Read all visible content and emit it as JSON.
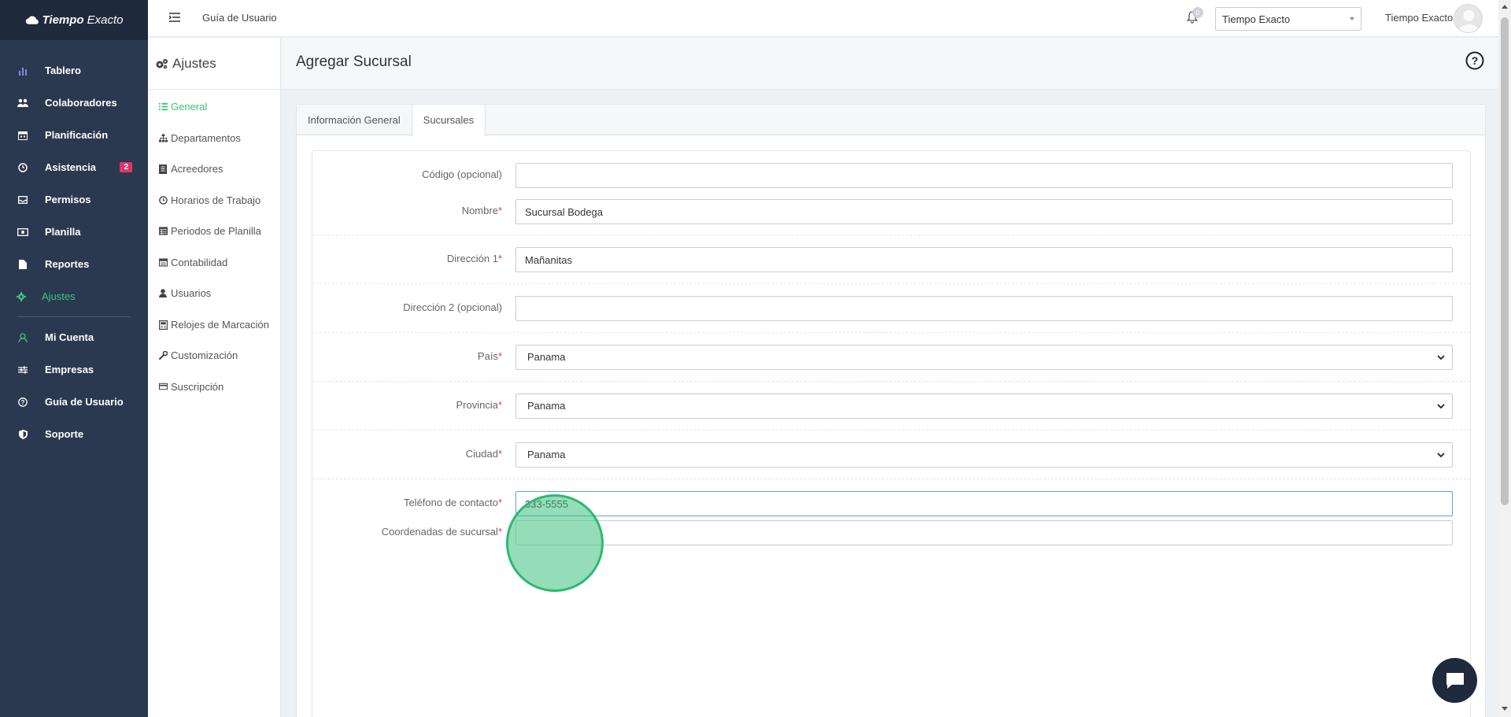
{
  "app": {
    "brand": "TiempoExacto",
    "brand_part1": "Tiempo",
    "brand_part2": "Exacto"
  },
  "sidebar": {
    "items": [
      {
        "label": "Tablero",
        "icon": "bar-chart-icon"
      },
      {
        "label": "Colaboradores",
        "icon": "users-icon"
      },
      {
        "label": "Planificación",
        "icon": "calendar-icon"
      },
      {
        "label": "Asistencia",
        "icon": "clock-icon",
        "badge": "2"
      },
      {
        "label": "Permisos",
        "icon": "inbox-icon"
      },
      {
        "label": "Planilla",
        "icon": "money-icon"
      },
      {
        "label": "Reportes",
        "icon": "file-icon"
      },
      {
        "label": "Ajustes",
        "icon": "gear-icon",
        "active": true
      },
      {
        "label": "Mi Cuenta",
        "icon": "user-icon"
      },
      {
        "label": "Empresas",
        "icon": "sliders-icon"
      },
      {
        "label": "Guía de Usuario",
        "icon": "question-circle-icon"
      },
      {
        "label": "Soporte",
        "icon": "shield-icon"
      }
    ]
  },
  "topbar": {
    "guide_link": "Guía de Usuario",
    "notification_count": "0",
    "company_selected": "Tiempo Exacto",
    "user_name": "Tiempo Exacto"
  },
  "settings_nav": {
    "title": "Ajustes",
    "items": [
      {
        "label": "General",
        "icon": "list-icon",
        "active": true
      },
      {
        "label": "Departamentos",
        "icon": "sitemap-icon"
      },
      {
        "label": "Acreedores",
        "icon": "book-icon"
      },
      {
        "label": "Horarios de Trabajo",
        "icon": "clock-icon"
      },
      {
        "label": "Periodos de Planilla",
        "icon": "table-icon"
      },
      {
        "label": "Contabilidad",
        "icon": "calculator-icon"
      },
      {
        "label": "Usuarios",
        "icon": "user-icon"
      },
      {
        "label": "Relojes de Marcación",
        "icon": "device-icon"
      },
      {
        "label": "Customización",
        "icon": "wrench-icon"
      },
      {
        "label": "Suscripción",
        "icon": "credit-card-icon"
      }
    ]
  },
  "page": {
    "title": "Agregar Sucursal",
    "tabs": [
      {
        "label": "Información General",
        "active": false
      },
      {
        "label": "Sucursales",
        "active": true
      }
    ]
  },
  "form": {
    "codigo": {
      "label": "Código (opcional)",
      "value": ""
    },
    "nombre": {
      "label": "Nombre",
      "value": "Sucursal Bodega"
    },
    "direccion1": {
      "label": "Dirección 1",
      "value": "Mañanitas"
    },
    "direccion2": {
      "label": "Dirección 2 (opcional)",
      "value": ""
    },
    "pais": {
      "label": "País",
      "value": "Panama"
    },
    "provincia": {
      "label": "Provincia",
      "value": "Panama"
    },
    "ciudad": {
      "label": "Ciudad",
      "value": "Panama"
    },
    "telefono": {
      "label": "Teléfono de contacto",
      "value": "333-5555"
    },
    "coordenadas": {
      "label": "Coordenadas de sucursal",
      "value": ""
    },
    "required_mark": "*"
  },
  "colors": {
    "sidebar_bg": "#2b3950",
    "accent_green": "#3cc17e",
    "badge_pink": "#e0356a"
  }
}
